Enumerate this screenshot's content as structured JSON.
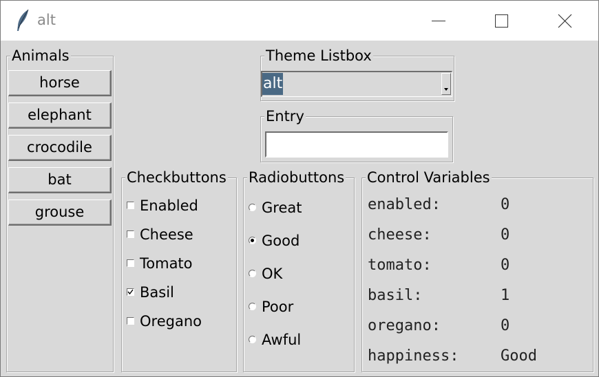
{
  "window": {
    "title": "alt",
    "icon": "feather-icon"
  },
  "titlebar_buttons": {
    "minimize": "minimize-icon",
    "maximize": "maximize-icon",
    "close": "close-icon"
  },
  "animals": {
    "label": "Animals",
    "buttons": [
      "horse",
      "elephant",
      "crocodile",
      "bat",
      "grouse"
    ]
  },
  "theme_listbox": {
    "label": "Theme Listbox",
    "selected": "alt"
  },
  "entry": {
    "label": "Entry",
    "value": ""
  },
  "checkbuttons": {
    "label": "Checkbuttons",
    "items": [
      {
        "label": "Enabled",
        "checked": false
      },
      {
        "label": "Cheese",
        "checked": false
      },
      {
        "label": "Tomato",
        "checked": false
      },
      {
        "label": "Basil",
        "checked": true
      },
      {
        "label": "Oregano",
        "checked": false
      }
    ]
  },
  "radiobuttons": {
    "label": "Radiobuttons",
    "items": [
      {
        "label": "Great",
        "selected": false
      },
      {
        "label": "Good",
        "selected": true
      },
      {
        "label": "OK",
        "selected": false
      },
      {
        "label": "Poor",
        "selected": false
      },
      {
        "label": "Awful",
        "selected": false
      }
    ]
  },
  "control_variables": {
    "label": "Control Variables",
    "rows": [
      {
        "name": "enabled:",
        "value": "0"
      },
      {
        "name": "cheese:",
        "value": "0"
      },
      {
        "name": "tomato:",
        "value": "0"
      },
      {
        "name": "basil:",
        "value": "1"
      },
      {
        "name": "oregano:",
        "value": "0"
      },
      {
        "name": "happiness:",
        "value": "Good"
      }
    ]
  },
  "colors": {
    "background": "#d9d9d9",
    "selection": "#4a6984",
    "title_text": "#8a8a8a"
  }
}
